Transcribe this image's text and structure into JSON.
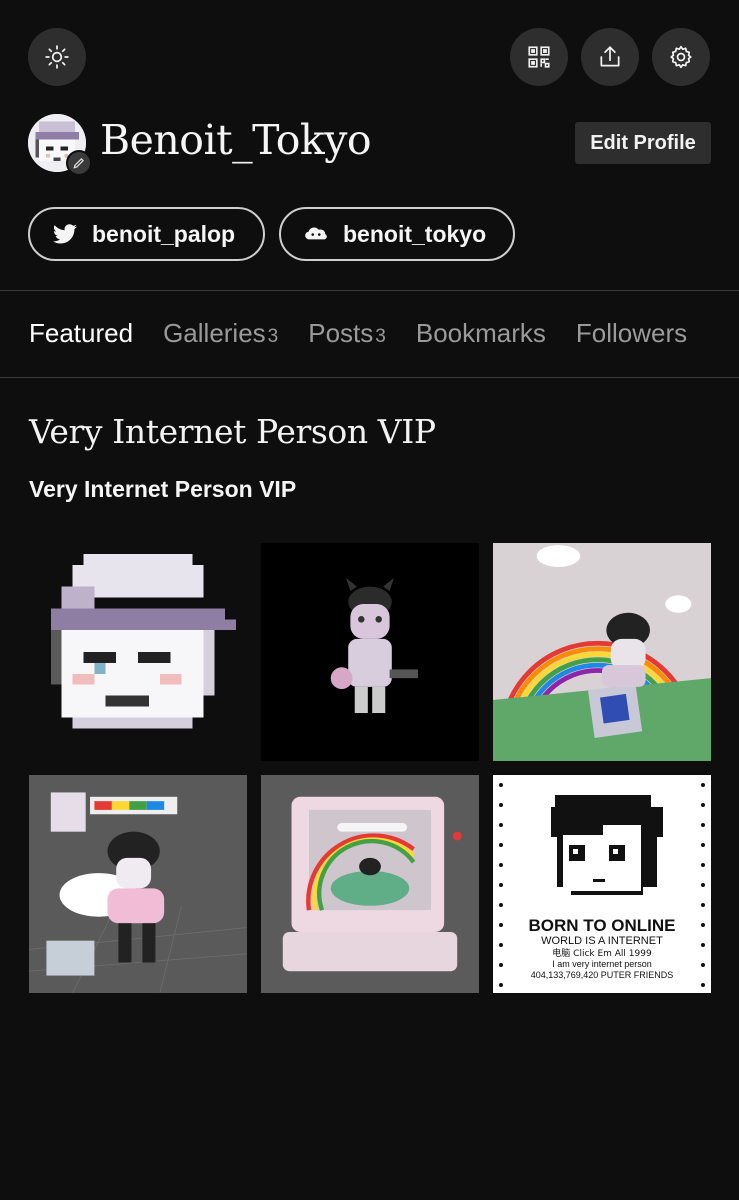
{
  "header": {
    "icons": {
      "theme": "sun-icon",
      "qr": "qr-code-icon",
      "share": "share-icon",
      "settings": "gear-icon"
    }
  },
  "profile": {
    "username": "Benoit_Tokyo",
    "edit_label": "Edit Profile",
    "socials": [
      {
        "icon": "twitter-icon",
        "handle": "benoit_palop"
      },
      {
        "icon": "cloud-icon",
        "handle": "benoit_tokyo"
      }
    ]
  },
  "tabs": [
    {
      "label": "Featured",
      "count": "",
      "active": true
    },
    {
      "label": "Galleries",
      "count": "3",
      "active": false
    },
    {
      "label": "Posts",
      "count": "3",
      "active": false
    },
    {
      "label": "Bookmarks",
      "count": "",
      "active": false
    },
    {
      "label": "Followers",
      "count": "",
      "active": false
    }
  ],
  "featured": {
    "title": "Very Internet Person VIP",
    "subtitle": "Very Internet Person VIP",
    "tiles": [
      {
        "name": "pixel-face-cap"
      },
      {
        "name": "3d-character-black"
      },
      {
        "name": "rainbow-island-character"
      },
      {
        "name": "character-super-bar"
      },
      {
        "name": "pink-computer-monitor"
      },
      {
        "name": "born-to-online-poster",
        "lines": [
          "BORN TO ONLINE",
          "WORLD IS A INTERNET",
          "电脑 Click Em All 1999",
          "I am very internet person",
          "404,133,769,420 PUTER FRIENDS"
        ]
      }
    ]
  },
  "colors": {
    "background": "#0e0e0e",
    "button_bg": "#2e2e2e",
    "text": "#f2f2f2",
    "muted": "#9a9a9a"
  }
}
